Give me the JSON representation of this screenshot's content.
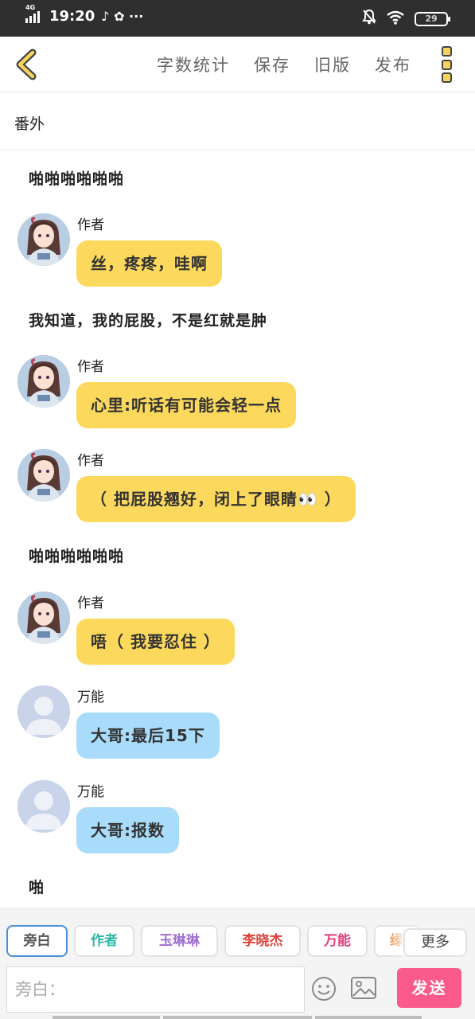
{
  "status_bar": {
    "network": "4G",
    "time": "19:20",
    "extra_icons": "♪ ✿ ···",
    "battery": "29"
  },
  "nav": {
    "back_icon": "chevron-left-icon",
    "actions": [
      "字数统计",
      "保存",
      "旧版",
      "发布"
    ],
    "more_icon": "vertical-dots-icon"
  },
  "chapter_title": "番外",
  "messages": [
    {
      "kind": "narration",
      "text": "啪啪啪啪啪啪"
    },
    {
      "kind": "bubble",
      "name": "作者",
      "text": "丝，疼疼，哇啊",
      "color": "#fcd95c",
      "avatar": "anime-girl"
    },
    {
      "kind": "narration",
      "text": "我知道，我的屁股，不是红就是肿"
    },
    {
      "kind": "bubble",
      "name": "作者",
      "text": "心里:听话有可能会轻一点",
      "color": "#fcd95c",
      "avatar": "anime-girl"
    },
    {
      "kind": "bubble",
      "name": "作者",
      "text": "（ 把屁股翘好，闭上了眼睛👀 ）",
      "color": "#fcd95c",
      "avatar": "anime-girl"
    },
    {
      "kind": "narration",
      "text": "啪啪啪啪啪啪"
    },
    {
      "kind": "bubble",
      "name": "作者",
      "text": "唔（ 我要忍住 ）",
      "color": "#fcd95c",
      "avatar": "anime-girl"
    },
    {
      "kind": "bubble",
      "name": "万能",
      "text": "大哥:最后15下",
      "color": "#a9dcfb",
      "avatar": "default-user"
    },
    {
      "kind": "bubble",
      "name": "万能",
      "text": "大哥:报数",
      "color": "#a9dcfb",
      "avatar": "default-user"
    },
    {
      "kind": "narration",
      "text": "啪"
    }
  ],
  "roles": [
    {
      "label": "旁白",
      "color": "#555555"
    },
    {
      "label": "作者",
      "color": "#2bb6a8"
    },
    {
      "label": "玉琳琳",
      "color": "#a070d0"
    },
    {
      "label": "李晓杰",
      "color": "#e0403a"
    },
    {
      "label": "万能",
      "color": "#e0407a"
    },
    {
      "label": "绿",
      "color": "#f0a060"
    }
  ],
  "more_label": "更多",
  "input": {
    "placeholder": "旁白："
  },
  "send_label": "发送"
}
